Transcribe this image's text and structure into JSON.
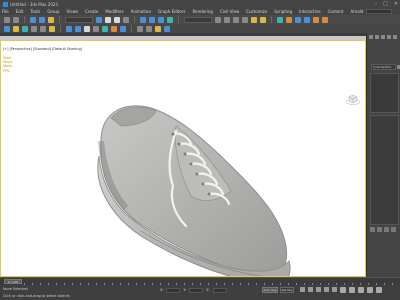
{
  "window": {
    "title": "Untitled - 3ds Max 2023",
    "controls": [
      "–",
      "□",
      "✕"
    ]
  },
  "menu": {
    "items": [
      "File",
      "Edit",
      "Tools",
      "Group",
      "Views",
      "Create",
      "Modifiers",
      "Animation",
      "Graph Editors",
      "Rendering",
      "Civil View",
      "Customize",
      "Scripting",
      "Interactive",
      "Content",
      "Arnold",
      "Help"
    ]
  },
  "viewport": {
    "label": "[+] [Perspective] [Standard] [Default Shading]",
    "stats": [
      "Total",
      "Polys:",
      "Verts:",
      "FPS:"
    ]
  },
  "command_panel": {
    "object_name": "Cylinder001"
  },
  "timeline": {
    "frame_display": "0 / 100"
  },
  "status": {
    "line1": "None Selected",
    "line2": "Click or click-and-drag to select objects",
    "x_label": "X:",
    "y_label": "Y:",
    "z_label": "Z:",
    "auto_key": "Auto Key",
    "set_key": "Set Key"
  },
  "colors": {
    "viewport_border": "#e7c84a",
    "viewport_bg": "#ffffff",
    "ui_dark": "#444444"
  },
  "icons": [
    "app-icon",
    "undo-icon",
    "redo-icon",
    "link-icon",
    "select-icon",
    "move-icon",
    "rotate-icon",
    "scale-icon",
    "snap-icon",
    "render-icon",
    "viewcube-icon",
    "play-icon",
    "zoom-icon",
    "pan-icon",
    "orbit-icon"
  ]
}
